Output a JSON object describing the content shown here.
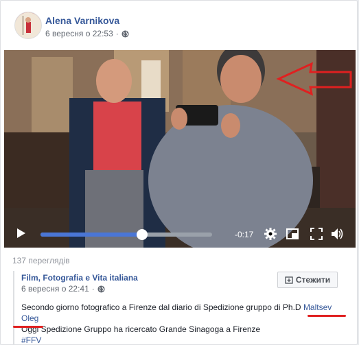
{
  "post": {
    "author": "Alena Varnikova",
    "timestamp": "6 вересня о 22:53"
  },
  "video": {
    "time_remaining": "-0:17",
    "progress": 0.59
  },
  "views": "137 переглядів",
  "shared": {
    "page_name": "Film, Fotografia e Vita italiana",
    "timestamp": "6 вересня о 22:41",
    "follow_label": "Стежити",
    "line1_text": "Secondo giorno fotografico a Firenze dal diario di Spedizione gruppo di Ph.D ",
    "line1_link": "Maltsev",
    "line2_link": "Oleg",
    "line3": "Oggi Spedizione Gruppo ha ricercato Grande Sinagoga a Firenze",
    "line4": "#FFV"
  },
  "colors": {
    "link": "#365899",
    "annotation": "#e02020",
    "progress": "#4a76d6"
  }
}
